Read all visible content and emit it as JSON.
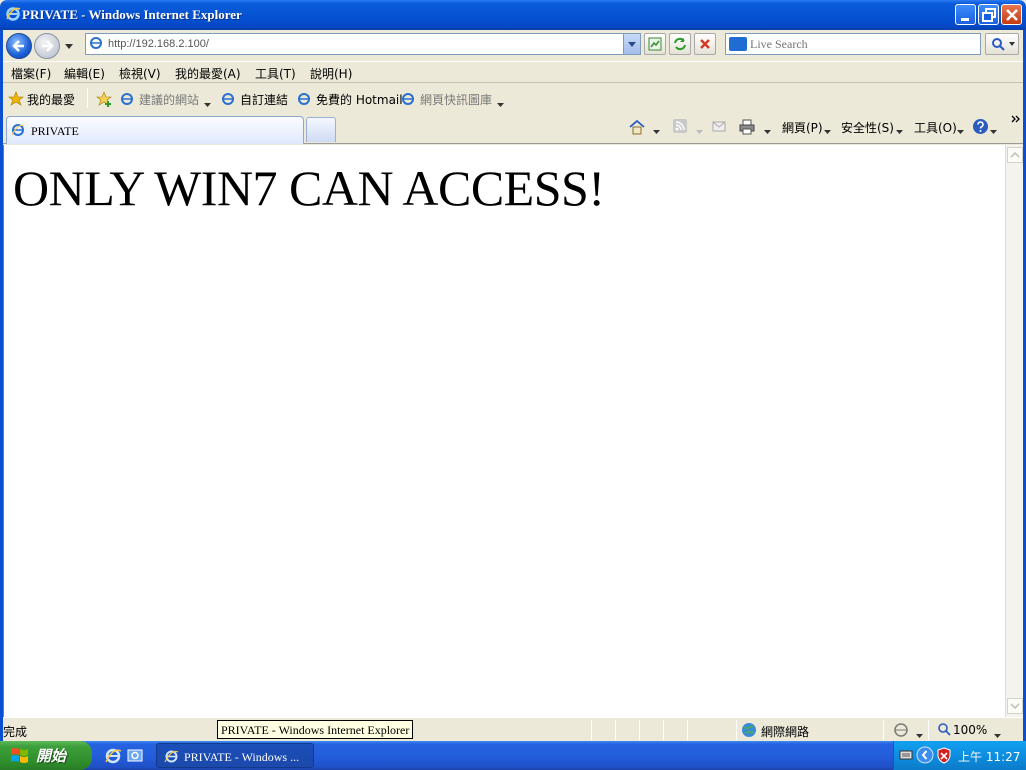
{
  "window": {
    "title": "PRIVATE - Windows Internet Explorer"
  },
  "navigation": {
    "url": "http://192.168.2.100/"
  },
  "search": {
    "placeholder": "Live Search"
  },
  "menu": [
    "檔案(F)",
    "編輯(E)",
    "檢視(V)",
    "我的最愛(A)",
    "工具(T)",
    "說明(H)"
  ],
  "favorites": {
    "main": "我的最愛",
    "links": [
      "建議的網站",
      "自訂連結",
      "免費的 Hotmail",
      "網頁快訊圖庫"
    ]
  },
  "tab": {
    "title": "PRIVATE"
  },
  "commandbar": {
    "page": "網頁(P)",
    "safety": "安全性(S)",
    "tools": "工具(O)"
  },
  "page": {
    "headline": "ONLY WIN7 CAN ACCESS!"
  },
  "status": {
    "text": "完成",
    "zone": "網際網路",
    "zoom": "100%",
    "tooltip": "PRIVATE - Windows Internet Explorer"
  },
  "taskbar": {
    "start": "開始",
    "task_button": "PRIVATE - Windows ...",
    "clock": "上午 11:27"
  }
}
